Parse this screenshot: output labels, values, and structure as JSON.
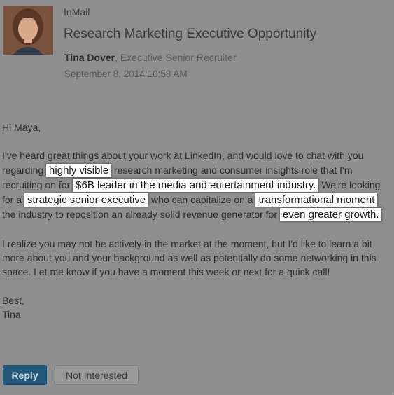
{
  "message": {
    "label": "InMail",
    "subject": "Research Marketing Executive Opportunity",
    "sender_name": "Tina Dover",
    "sender_title": ", Executive Senior Recruiter",
    "date": "September 8, 2014 10:58 AM"
  },
  "body": {
    "greeting": "Hi Maya,",
    "p1_a": "I've heard great things about your work at LinkedIn, and would love to chat with you regarding ",
    "p1_hl1": "highly visible",
    "p1_b": " research marketing and consumer insights role that I'm recruiting on for ",
    "p1_hl2": "$6B leader in the media and entertainment industry.",
    "p1_c": " We're looking for a ",
    "p1_hl3": "strategic senior executive",
    "p1_d": " who can capitalize on a ",
    "p1_hl4": "transformational moment",
    "p1_e": " the industry to reposition an already solid revenue generator for ",
    "p1_hl5": "even greater growth.",
    "p2": "I realize you may not be actively in the market at the moment, but I'd like to learn a bit more about you and your background as well as potentially do some networking in this space. Let me know if you have a moment this week or next for a quick call!",
    "closing": "Best,",
    "signoff": "Tina"
  },
  "actions": {
    "reply": "Reply",
    "not_interested": "Not Interested"
  },
  "colors": {
    "overlay": "#8f8f8f",
    "highlight": "#ffffff",
    "reply_button": "#23587a"
  },
  "icons": {
    "avatar": "sender-profile-photo"
  }
}
